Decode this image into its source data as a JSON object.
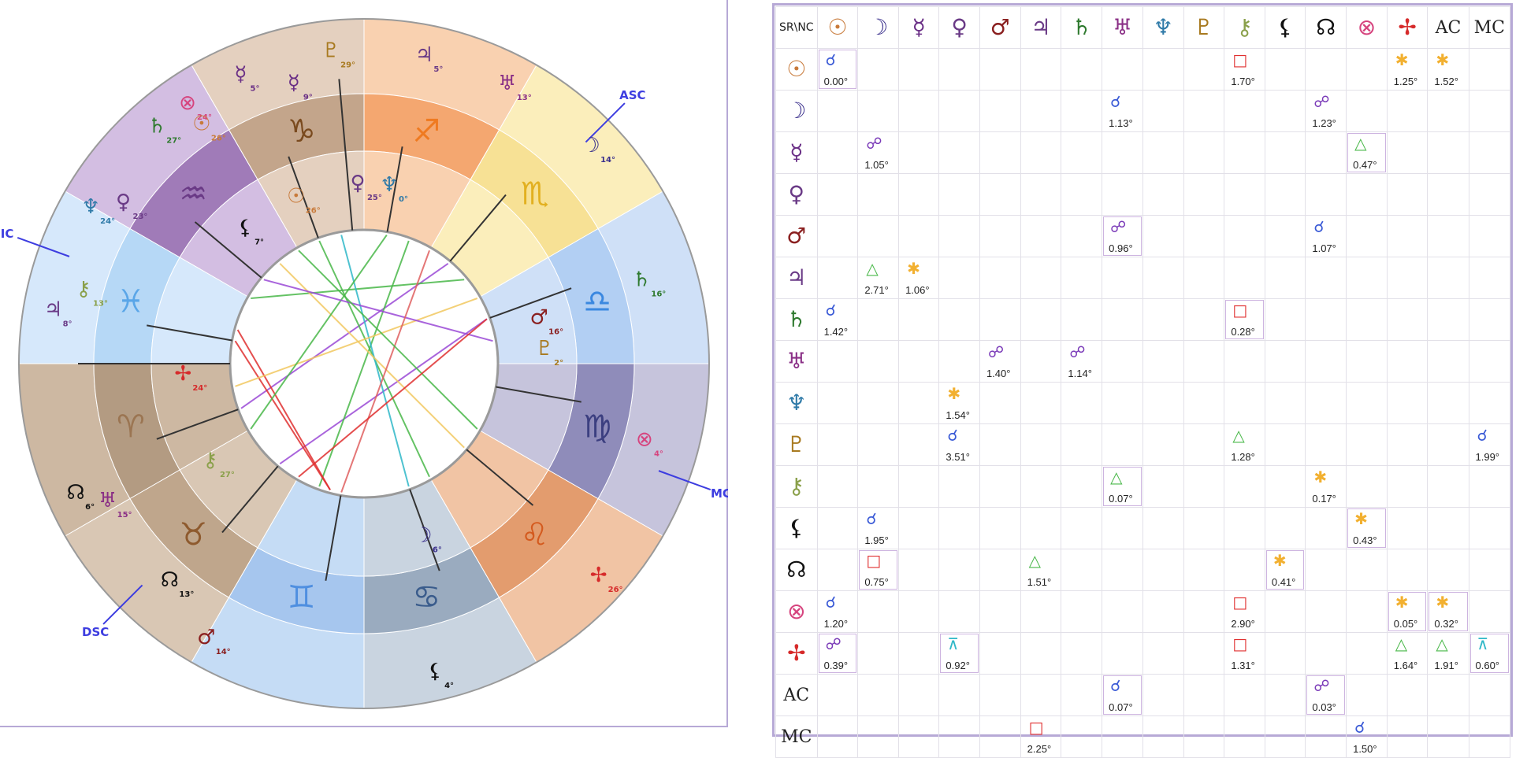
{
  "chart": {
    "angle_labels": [
      {
        "label": "ASC",
        "deg": 45
      },
      {
        "label": "IC",
        "deg": 160
      },
      {
        "label": "DSC",
        "deg": 225
      },
      {
        "label": "MC",
        "deg": 340
      }
    ],
    "signs": [
      {
        "name": "aries",
        "glyph": "♈",
        "color": "#9b7552",
        "start": 180,
        "ring": "#cdb8a2",
        "inner": "#b39b82"
      },
      {
        "name": "taurus",
        "glyph": "♉",
        "color": "#8e5a2e",
        "start": 210,
        "ring": "#d9c7b4",
        "inner": "#bfa68c"
      },
      {
        "name": "gemini",
        "glyph": "♊",
        "color": "#4f8fe0",
        "start": 240,
        "ring": "#c5dcf5",
        "inner": "#a6c6ee"
      },
      {
        "name": "cancer",
        "glyph": "♋",
        "color": "#3a5c8c",
        "start": 270,
        "ring": "#c9d4e0",
        "inner": "#9aabbf"
      },
      {
        "name": "leo",
        "glyph": "♌",
        "color": "#d45a1e",
        "start": 300,
        "ring": "#f1c4a4",
        "inner": "#e39c6e"
      },
      {
        "name": "virgo",
        "glyph": "♍",
        "color": "#3c3f80",
        "start": 330,
        "ring": "#c6c4dc",
        "inner": "#8f8cba"
      },
      {
        "name": "libra",
        "glyph": "♎",
        "color": "#3b88e0",
        "start": 0,
        "ring": "#cfe0f7",
        "inner": "#b2cff3"
      },
      {
        "name": "scorpio",
        "glyph": "♏",
        "color": "#e2b020",
        "start": 30,
        "ring": "#fbeebb",
        "inner": "#f7e195"
      },
      {
        "name": "sagittarius",
        "glyph": "♐",
        "color": "#ef7a20",
        "start": 60,
        "ring": "#f9d1b0",
        "inner": "#f4a770"
      },
      {
        "name": "capricorn",
        "glyph": "♑",
        "color": "#7a4a1e",
        "start": 90,
        "ring": "#e4d0bf",
        "inner": "#c3a58b"
      },
      {
        "name": "aquarius",
        "glyph": "♒",
        "color": "#6a3a86",
        "start": 120,
        "ring": "#d3bee2",
        "inner": "#a07bb8"
      },
      {
        "name": "pisces",
        "glyph": "♓",
        "color": "#5aa6e8",
        "start": 150,
        "ring": "#d6e8fb",
        "inner": "#b6d8f6"
      }
    ],
    "planets": [
      {
        "name": "moon",
        "glyph": "☽",
        "color": "#3a2f8c",
        "deg": 44,
        "deg_text": "14°",
        "ring": "outer"
      },
      {
        "name": "jupiter",
        "glyph": "♃",
        "color": "#6a3a86",
        "deg": 79,
        "deg_text": "5°",
        "ring": "outer"
      },
      {
        "name": "uranus",
        "glyph": "♅",
        "color": "#8a2f86",
        "deg": 63,
        "deg_text": "13°",
        "ring": "outer"
      },
      {
        "name": "pluto",
        "glyph": "♇",
        "color": "#a87a20",
        "deg": 96,
        "deg_text": "29°",
        "ring": "outer"
      },
      {
        "name": "mercury",
        "glyph": "☿",
        "color": "#6a2f86",
        "deg": 113,
        "deg_text": "5°",
        "ring": "outer"
      },
      {
        "name": "mercury",
        "glyph": "☿",
        "color": "#6a2f86",
        "deg": 104,
        "deg_text": "9°",
        "ring": "mid"
      },
      {
        "name": "part-of-fortune",
        "glyph": "⊗",
        "color": "#d6447e",
        "deg": 124,
        "deg_text": "24°",
        "ring": "outer"
      },
      {
        "name": "sun",
        "glyph": "☉",
        "color": "#c87a3a",
        "deg": 124,
        "deg_text": "26°",
        "ring": "mid"
      },
      {
        "name": "saturn",
        "glyph": "♄",
        "color": "#2f7a2f",
        "deg": 131,
        "deg_text": "27°",
        "ring": "outer"
      },
      {
        "name": "neptune",
        "glyph": "♆",
        "color": "#2f7aa8",
        "deg": 150,
        "deg_text": "24°",
        "ring": "outer"
      },
      {
        "name": "venus",
        "glyph": "♀",
        "color": "#6a3a86",
        "deg": 146,
        "deg_text": "23°",
        "ring": "mid"
      },
      {
        "name": "lilith",
        "glyph": "⚸",
        "color": "#111111",
        "deg": 131,
        "deg_text": "7°",
        "ring": "inner"
      },
      {
        "name": "sun",
        "glyph": "☉",
        "color": "#c87a3a",
        "deg": 112,
        "deg_text": "26°",
        "ring": "inner"
      },
      {
        "name": "venus",
        "glyph": "♀",
        "color": "#6a3a86",
        "deg": 92,
        "deg_text": "25°",
        "ring": "inner"
      },
      {
        "name": "neptune",
        "glyph": "♆",
        "color": "#2f7aa8",
        "deg": 82,
        "deg_text": "0°",
        "ring": "inner"
      },
      {
        "name": "jupiter",
        "glyph": "♃",
        "color": "#6a3a86",
        "deg": 170,
        "deg_text": "8°",
        "ring": "outer"
      },
      {
        "name": "chiron",
        "glyph": "⚷",
        "color": "#8aa04a",
        "deg": 165,
        "deg_text": "13°",
        "ring": "mid"
      },
      {
        "name": "vertex",
        "glyph": "✢",
        "color": "#d62a2a",
        "deg": 183,
        "deg_text": "24°",
        "ring": "inner"
      },
      {
        "name": "north-node",
        "glyph": "☊",
        "color": "#111111",
        "deg": 204,
        "deg_text": "6°",
        "ring": "outer"
      },
      {
        "name": "uranus",
        "glyph": "♅",
        "color": "#8a2f86",
        "deg": 208,
        "deg_text": "15°",
        "ring": "mid"
      },
      {
        "name": "chiron",
        "glyph": "⚷",
        "color": "#8aa04a",
        "deg": 212,
        "deg_text": "27°",
        "ring": "inner"
      },
      {
        "name": "north-node",
        "glyph": "☊",
        "color": "#111111",
        "deg": 228,
        "deg_text": "13°",
        "ring": "mid"
      },
      {
        "name": "mars",
        "glyph": "♂",
        "color": "#8a1f1f",
        "deg": 240,
        "deg_text": "14°",
        "ring": "outer"
      },
      {
        "name": "moon",
        "glyph": "☽",
        "color": "#3a2f8c",
        "deg": 289,
        "deg_text": "6°",
        "ring": "inner"
      },
      {
        "name": "lilith",
        "glyph": "⚸",
        "color": "#111111",
        "deg": 283,
        "deg_text": "4°",
        "ring": "outer"
      },
      {
        "name": "vertex",
        "glyph": "✢",
        "color": "#d62a2a",
        "deg": 318,
        "deg_text": "26°",
        "ring": "outer"
      },
      {
        "name": "part-of-fortune",
        "glyph": "⊗",
        "color": "#d6447e",
        "deg": 345,
        "deg_text": "4°",
        "ring": "mid"
      },
      {
        "name": "pluto",
        "glyph": "♇",
        "color": "#a87a20",
        "deg": 5,
        "deg_text": "2°",
        "ring": "inner"
      },
      {
        "name": "mars",
        "glyph": "♂",
        "color": "#8a1f1f",
        "deg": 15,
        "deg_text": "16°",
        "ring": "inner"
      },
      {
        "name": "saturn",
        "glyph": "♄",
        "color": "#2f7a2f",
        "deg": 17,
        "deg_text": "16°",
        "ring": "mid"
      }
    ]
  },
  "grid": {
    "corner": "SR\\NC",
    "columns": [
      {
        "name": "sun",
        "glyph": "☉",
        "color": "#c87a3a"
      },
      {
        "name": "moon",
        "glyph": "☽",
        "color": "#3a2f8c"
      },
      {
        "name": "mercury",
        "glyph": "☿",
        "color": "#6a2f86"
      },
      {
        "name": "venus",
        "glyph": "♀",
        "color": "#6a3a86"
      },
      {
        "name": "mars",
        "glyph": "♂",
        "color": "#8a1f1f"
      },
      {
        "name": "jupiter",
        "glyph": "♃",
        "color": "#6a3a86"
      },
      {
        "name": "saturn",
        "glyph": "♄",
        "color": "#2f7a2f"
      },
      {
        "name": "uranus",
        "glyph": "♅",
        "color": "#8a2f86"
      },
      {
        "name": "neptune",
        "glyph": "♆",
        "color": "#2f7aa8"
      },
      {
        "name": "pluto",
        "glyph": "♇",
        "color": "#a87a20"
      },
      {
        "name": "chiron",
        "glyph": "⚷",
        "color": "#8aa04a"
      },
      {
        "name": "lilith",
        "glyph": "⚸",
        "color": "#111111"
      },
      {
        "name": "north-node",
        "glyph": "☊",
        "color": "#111111"
      },
      {
        "name": "part-of-fortune",
        "glyph": "⊗",
        "color": "#d6447e"
      },
      {
        "name": "vertex",
        "glyph": "✢",
        "color": "#d62a2a"
      },
      {
        "name": "ac",
        "text": "AC"
      },
      {
        "name": "mc",
        "text": "MC"
      }
    ],
    "rows": [
      {
        "name": "sun",
        "glyph": "☉",
        "color": "#c87a3a",
        "cells": [
          {
            "col": 0,
            "type": "conjunction",
            "orb": "0.00°",
            "box": true
          },
          {
            "col": 10,
            "type": "square",
            "orb": "1.70°"
          },
          {
            "col": 14,
            "type": "sextile",
            "orb": "1.25°"
          },
          {
            "col": 15,
            "type": "sextile",
            "orb": "1.52°"
          }
        ]
      },
      {
        "name": "moon",
        "glyph": "☽",
        "color": "#3a2f8c",
        "cells": [
          {
            "col": 7,
            "type": "conjunction",
            "orb": "1.13°"
          },
          {
            "col": 12,
            "type": "opposition",
            "orb": "1.23°"
          }
        ]
      },
      {
        "name": "mercury",
        "glyph": "☿",
        "color": "#6a2f86",
        "cells": [
          {
            "col": 1,
            "type": "opposition",
            "orb": "1.05°"
          },
          {
            "col": 13,
            "type": "trine",
            "orb": "0.47°",
            "box": true
          }
        ]
      },
      {
        "name": "venus",
        "glyph": "♀",
        "color": "#6a3a86",
        "cells": []
      },
      {
        "name": "mars",
        "glyph": "♂",
        "color": "#8a1f1f",
        "cells": [
          {
            "col": 7,
            "type": "opposition",
            "orb": "0.96°",
            "box": true
          },
          {
            "col": 12,
            "type": "conjunction",
            "orb": "1.07°"
          }
        ]
      },
      {
        "name": "jupiter",
        "glyph": "♃",
        "color": "#6a3a86",
        "cells": [
          {
            "col": 1,
            "type": "trine",
            "orb": "2.71°"
          },
          {
            "col": 2,
            "type": "sextile",
            "orb": "1.06°"
          }
        ]
      },
      {
        "name": "saturn",
        "glyph": "♄",
        "color": "#2f7a2f",
        "cells": [
          {
            "col": 0,
            "type": "conjunction",
            "orb": "1.42°"
          },
          {
            "col": 10,
            "type": "square",
            "orb": "0.28°",
            "box": true
          }
        ]
      },
      {
        "name": "uranus",
        "glyph": "♅",
        "color": "#8a2f86",
        "cells": [
          {
            "col": 4,
            "type": "opposition",
            "orb": "1.40°"
          },
          {
            "col": 6,
            "type": "opposition",
            "orb": "1.14°"
          }
        ]
      },
      {
        "name": "neptune",
        "glyph": "♆",
        "color": "#2f7aa8",
        "cells": [
          {
            "col": 3,
            "type": "sextile",
            "orb": "1.54°"
          }
        ]
      },
      {
        "name": "pluto",
        "glyph": "♇",
        "color": "#a87a20",
        "cells": [
          {
            "col": 3,
            "type": "conjunction",
            "orb": "3.51°"
          },
          {
            "col": 10,
            "type": "trine",
            "orb": "1.28°"
          },
          {
            "col": 16,
            "type": "conjunction",
            "orb": "1.99°"
          }
        ]
      },
      {
        "name": "chiron",
        "glyph": "⚷",
        "color": "#8aa04a",
        "cells": [
          {
            "col": 7,
            "type": "trine",
            "orb": "0.07°",
            "box": true
          },
          {
            "col": 12,
            "type": "sextile",
            "orb": "0.17°"
          }
        ]
      },
      {
        "name": "lilith",
        "glyph": "⚸",
        "color": "#111111",
        "cells": [
          {
            "col": 1,
            "type": "conjunction",
            "orb": "1.95°"
          },
          {
            "col": 13,
            "type": "sextile",
            "orb": "0.43°",
            "box": true
          }
        ]
      },
      {
        "name": "north-node",
        "glyph": "☊",
        "color": "#111111",
        "cells": [
          {
            "col": 1,
            "type": "square",
            "orb": "0.75°",
            "box": true
          },
          {
            "col": 5,
            "type": "trine",
            "orb": "1.51°"
          },
          {
            "col": 11,
            "type": "sextile",
            "orb": "0.41°",
            "box": true
          }
        ]
      },
      {
        "name": "part-of-fortune",
        "glyph": "⊗",
        "color": "#d6447e",
        "cells": [
          {
            "col": 0,
            "type": "conjunction",
            "orb": "1.20°"
          },
          {
            "col": 10,
            "type": "square",
            "orb": "2.90°"
          },
          {
            "col": 14,
            "type": "sextile",
            "orb": "0.05°",
            "box": true
          },
          {
            "col": 15,
            "type": "sextile",
            "orb": "0.32°",
            "box": true
          }
        ]
      },
      {
        "name": "vertex",
        "glyph": "✢",
        "color": "#d62a2a",
        "cells": [
          {
            "col": 0,
            "type": "opposition",
            "orb": "0.39°",
            "box": true
          },
          {
            "col": 3,
            "type": "quincunx",
            "orb": "0.92°",
            "box": true
          },
          {
            "col": 10,
            "type": "square",
            "orb": "1.31°"
          },
          {
            "col": 14,
            "type": "trine",
            "orb": "1.64°"
          },
          {
            "col": 15,
            "type": "trine",
            "orb": "1.91°"
          },
          {
            "col": 16,
            "type": "quincunx",
            "orb": "0.60°",
            "box": true
          }
        ]
      },
      {
        "name": "ac",
        "text": "AC",
        "cells": [
          {
            "col": 7,
            "type": "conjunction",
            "orb": "0.07°",
            "box": true
          },
          {
            "col": 12,
            "type": "opposition",
            "orb": "0.03°",
            "box": true
          }
        ]
      },
      {
        "name": "mc",
        "text": "MC",
        "cells": [
          {
            "col": 5,
            "type": "square",
            "orb": "2.25°"
          },
          {
            "col": 13,
            "type": "conjunction",
            "orb": "1.50°"
          }
        ]
      }
    ],
    "aspect_styles": {
      "conjunction": {
        "glyph": "☌",
        "color": "#3a5ad6"
      },
      "opposition": {
        "glyph": "☍",
        "color": "#7a3ab8"
      },
      "square": {
        "glyph": "□",
        "color": "#e03030"
      },
      "trine": {
        "glyph": "△",
        "color": "#4ab84a"
      },
      "sextile": {
        "glyph": "✱",
        "color": "#f2b030"
      },
      "quincunx": {
        "glyph": "⊼",
        "color": "#30b8c8"
      }
    }
  }
}
